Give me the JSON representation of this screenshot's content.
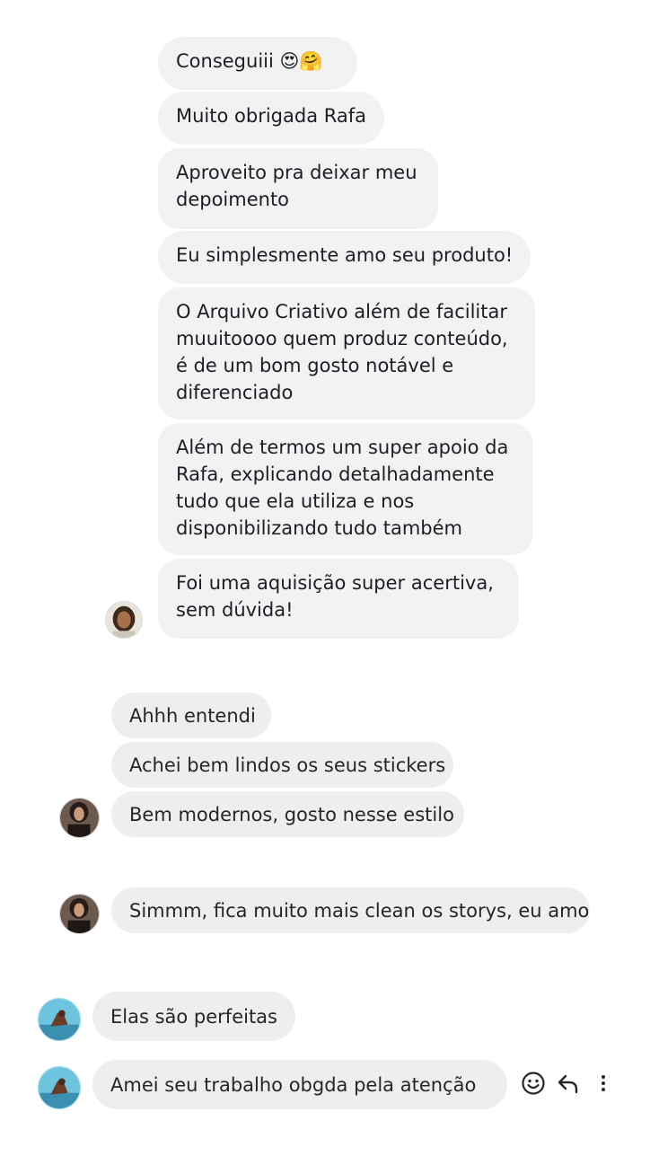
{
  "conversation": {
    "group1": [
      {
        "text": "Conseguiii",
        "emoji": "😍🤗"
      },
      {
        "text": "Muito obrigada Rafa"
      },
      {
        "lines": [
          "Aproveito pra deixar meu",
          "depoimento"
        ]
      },
      {
        "text": "Eu simplesmente amo seu produto!"
      },
      {
        "lines": [
          "O Arquivo Criativo além de facilitar",
          "muuitoooo quem produz conteúdo,",
          "é de um bom gosto notável e",
          "diferenciado"
        ]
      },
      {
        "lines": [
          "Além de termos um super apoio da",
          "Rafa, explicando detalhadamente",
          "tudo que ela utiliza e nos",
          "disponibilizando tudo também"
        ]
      },
      {
        "lines": [
          "Foi uma aquisição super acertiva,",
          "sem dúvida!"
        ]
      }
    ],
    "group2": [
      {
        "text": "Ahhh entendi"
      },
      {
        "text": "Achei bem lindos os seus stickers"
      },
      {
        "text": "Bem modernos, gosto nesse estilo"
      }
    ],
    "group3": [
      {
        "text": "Simmm, fica muito mais clean os storys, eu amo"
      }
    ],
    "group4": [
      {
        "text": "Elas são perfeitas"
      },
      {
        "text": "Amei seu trabalho obgda pela atenção"
      }
    ]
  },
  "icons": {
    "react": "smiley-icon",
    "reply": "reply-icon",
    "more": "more-vertical-icon"
  },
  "colors": {
    "bubble_light": "#f1f2f4",
    "bubble_gray": "#eeeeee",
    "text": "#1c1e21"
  }
}
